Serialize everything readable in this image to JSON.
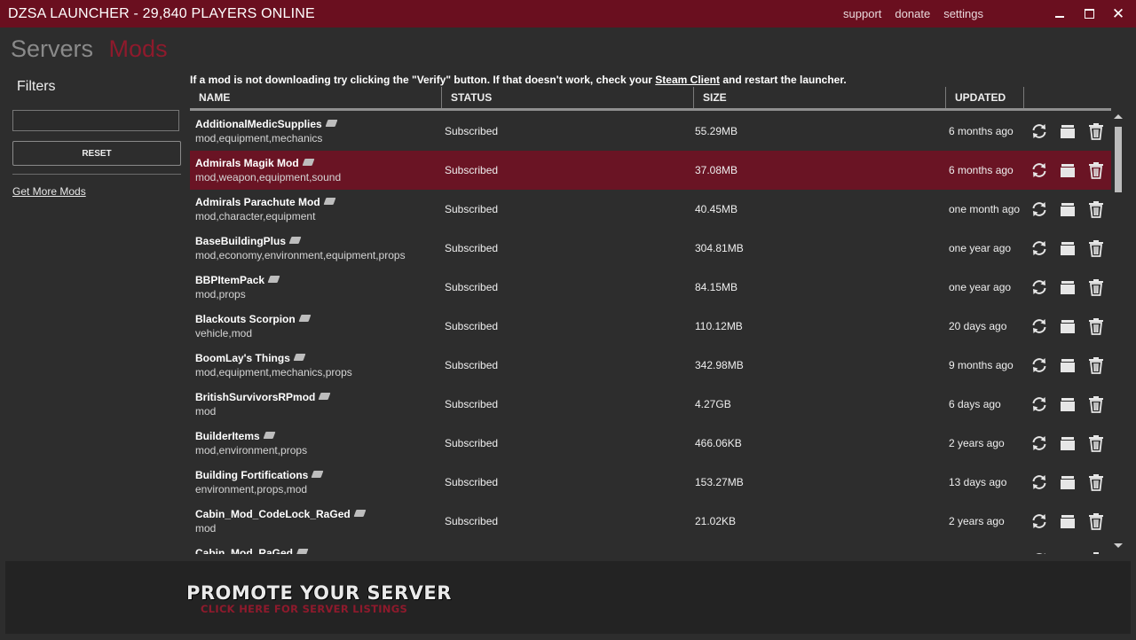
{
  "window": {
    "title": "DZSA LAUNCHER - 29,840 PLAYERS ONLINE",
    "links": [
      "support",
      "donate",
      "settings"
    ]
  },
  "nav": {
    "servers": "Servers",
    "mods": "Mods"
  },
  "sidebar": {
    "filters_title": "Filters",
    "filter_value": "",
    "reset_label": "RESET",
    "get_more_mods": "Get More Mods"
  },
  "notice": {
    "before": "If a mod is not downloading try clicking the \"Verify\" button. If that doesn't work, check your ",
    "link": "Steam Client",
    "after": " and restart the launcher."
  },
  "table": {
    "headers": {
      "name": "NAME",
      "status": "STATUS",
      "size": "SIZE",
      "updated": "UPDATED"
    },
    "rows": [
      {
        "name": "AdditionalMedicSupplies",
        "tags": "mod,equipment,mechanics",
        "status": "Subscribed",
        "size": "55.29MB",
        "updated": "6 months ago",
        "selected": false
      },
      {
        "name": "Admirals Magik Mod",
        "tags": "mod,weapon,equipment,sound",
        "status": "Subscribed",
        "size": "37.08MB",
        "updated": "6 months ago",
        "selected": true
      },
      {
        "name": "Admirals Parachute Mod",
        "tags": "mod,character,equipment",
        "status": "Subscribed",
        "size": "40.45MB",
        "updated": "one month ago",
        "selected": false
      },
      {
        "name": "BaseBuildingPlus",
        "tags": "mod,economy,environment,equipment,props",
        "status": "Subscribed",
        "size": "304.81MB",
        "updated": "one year ago",
        "selected": false
      },
      {
        "name": "BBPItemPack",
        "tags": "mod,props",
        "status": "Subscribed",
        "size": "84.15MB",
        "updated": "one year ago",
        "selected": false
      },
      {
        "name": "Blackouts Scorpion",
        "tags": "vehicle,mod",
        "status": "Subscribed",
        "size": "110.12MB",
        "updated": "20 days ago",
        "selected": false
      },
      {
        "name": "BoomLay's Things",
        "tags": "mod,equipment,mechanics,props",
        "status": "Subscribed",
        "size": "342.98MB",
        "updated": "9 months ago",
        "selected": false
      },
      {
        "name": "BritishSurvivorsRPmod",
        "tags": "mod",
        "status": "Subscribed",
        "size": "4.27GB",
        "updated": "6 days ago",
        "selected": false
      },
      {
        "name": "BuilderItems",
        "tags": "mod,environment,props",
        "status": "Subscribed",
        "size": "466.06KB",
        "updated": "2 years ago",
        "selected": false
      },
      {
        "name": "Building Fortifications",
        "tags": "environment,props,mod",
        "status": "Subscribed",
        "size": "153.27MB",
        "updated": "13 days ago",
        "selected": false
      },
      {
        "name": "Cabin_Mod_CodeLock_RaGed",
        "tags": "mod",
        "status": "Subscribed",
        "size": "21.02KB",
        "updated": "2 years ago",
        "selected": false
      },
      {
        "name": "Cabin_Mod_RaGed",
        "tags": "",
        "status": "",
        "size": "",
        "updated": "",
        "selected": false
      }
    ]
  },
  "footer": {
    "promo_title": "PROMOTE YOUR SERVER",
    "promo_subtitle": "CLICK HERE FOR SERVER LISTINGS"
  },
  "icons": {
    "refresh": "refresh-icon",
    "folder": "folder-icon",
    "trash": "trash-icon",
    "steam": "steam-icon"
  },
  "colors": {
    "accent": "#6a0f1f",
    "selected_row": "#6a1424",
    "mods_tab": "#8e1a2c",
    "background": "#2d2d2d"
  }
}
